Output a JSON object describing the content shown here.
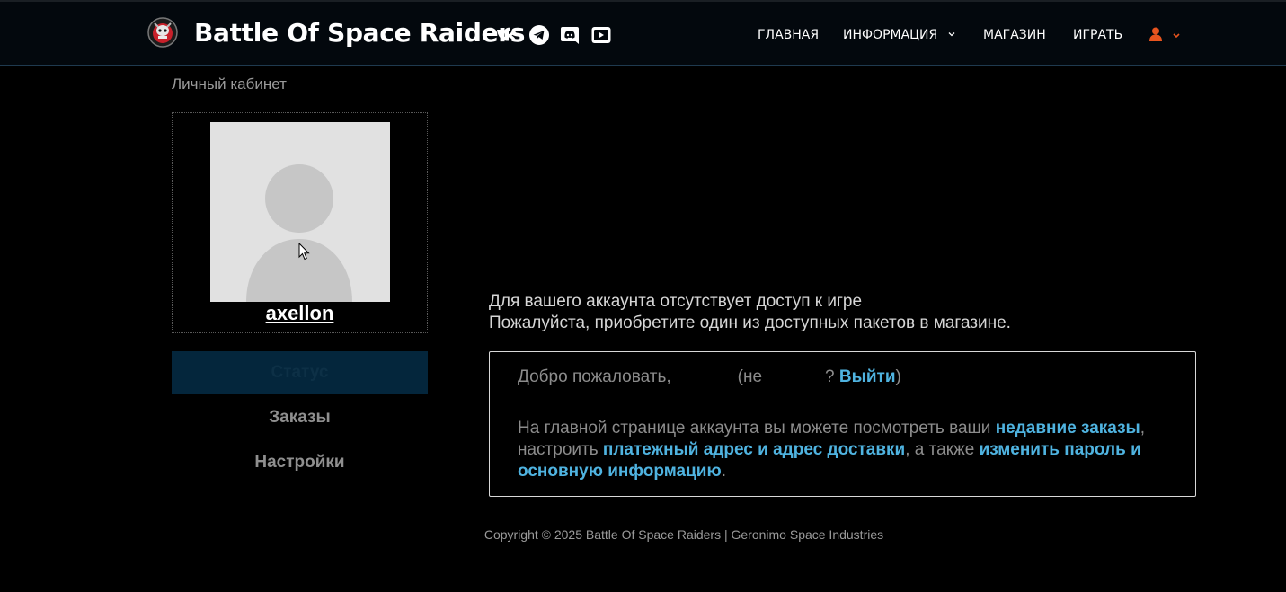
{
  "header": {
    "site_title": "Battle Of Space Raiders",
    "social": [
      "vk-icon",
      "telegram-icon",
      "discord-icon",
      "youtube-icon"
    ],
    "nav": {
      "home": "ГЛАВНАЯ",
      "info": "ИНФОРМАЦИЯ",
      "shop": "МАГАЗИН",
      "play": "ИГРАТЬ"
    },
    "accent_color": "#e8541e"
  },
  "breadcrumb": "Личный кабинет",
  "profile": {
    "username": "axellon"
  },
  "side_menu": {
    "status": "Статус",
    "orders": "Заказы",
    "settings": "Настройки"
  },
  "notice": {
    "line1": "Для вашего аккаунта отсутствует доступ к игре",
    "line2": "Пожалуйста, приобретите один из доступных пакетов в магазине."
  },
  "welcome": {
    "greeting": "Добро пожаловать,",
    "not_prefix": "(не",
    "question": "?",
    "logout": "Выйти",
    "close_paren": ")",
    "desc_part1": "На главной странице аккаунта вы можете посмотреть ваши ",
    "link_orders": "недавние заказы",
    "desc_part2": ", настроить ",
    "link_address": "платежный адрес и адрес доставки",
    "desc_part3": ", а также ",
    "link_password": "изменить пароль и основную информацию",
    "desc_part4": "."
  },
  "footer": "Copyright © 2025 Battle Of Space Raiders | Geronimo Space Industries"
}
